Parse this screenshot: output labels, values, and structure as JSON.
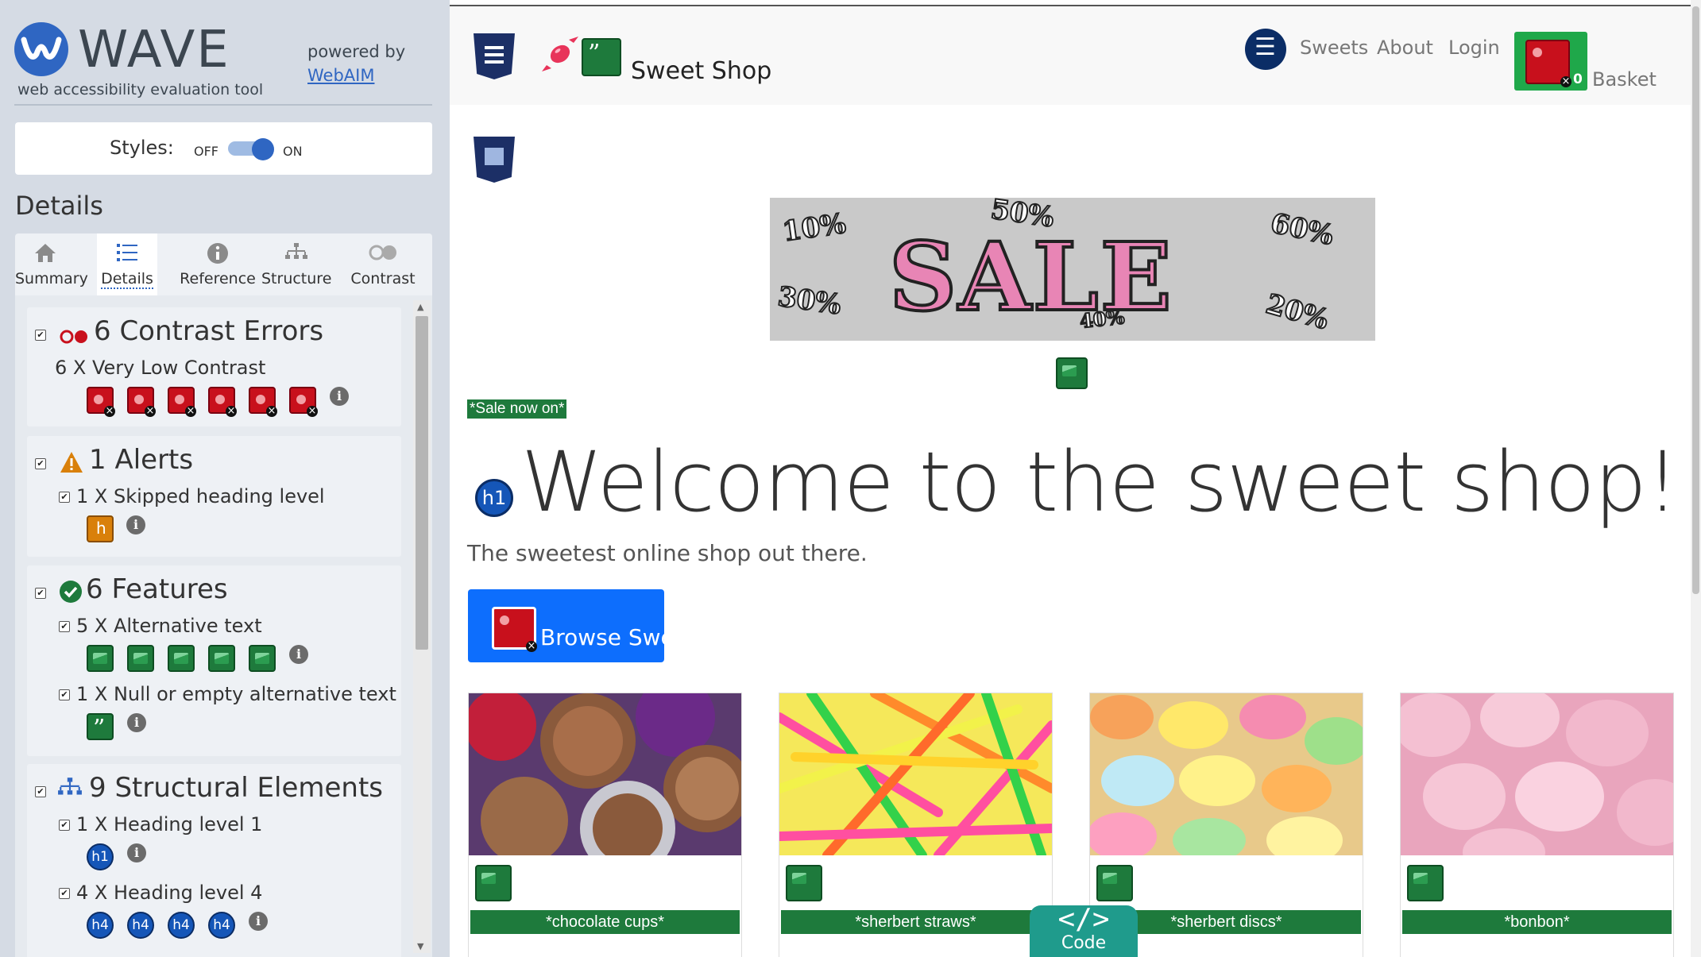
{
  "wave": {
    "title": "WAVE",
    "subtitle": "web accessibility evaluation tool",
    "powered_by": "powered by",
    "webaim": "WebAIM",
    "styles_label": "Styles:",
    "toggle_off": "OFF",
    "toggle_on": "ON",
    "details_heading": "Details",
    "tabs": [
      {
        "label": "Summary",
        "icon": "home-icon"
      },
      {
        "label": "Details",
        "icon": "list-icon",
        "active": true
      },
      {
        "label": "Reference",
        "icon": "info-icon"
      },
      {
        "label": "Structure",
        "icon": "structure-icon"
      },
      {
        "label": "Contrast",
        "icon": "contrast-icon"
      }
    ],
    "errors": {
      "title": "6 Contrast Errors",
      "item": "6 X Very Low Contrast",
      "count": 6
    },
    "alerts": {
      "title": "1 Alerts",
      "item": "1 X Skipped heading level",
      "count": 1
    },
    "features": {
      "title": "6 Features",
      "items": [
        {
          "label": "5 X Alternative text",
          "count": 5
        },
        {
          "label": "1 X Null or empty alternative text",
          "count": 1
        }
      ]
    },
    "structure": {
      "title": "9 Structural Elements",
      "items": [
        {
          "label": "1 X Heading level 1",
          "badge": "h1",
          "count": 1
        },
        {
          "label": "4 X Heading level 4",
          "badge": "h4",
          "count": 4
        }
      ]
    },
    "colors": {
      "error": "#c8101c",
      "alert": "#d9800a",
      "feature": "#1e7a3c",
      "structure": "#1556b8",
      "panel": "#d5dbe4"
    }
  },
  "site": {
    "brand": "Sweet Shop",
    "nav": [
      "Sweets",
      "About",
      "Login"
    ],
    "basket_count": "0",
    "basket_label": "Basket",
    "banner": {
      "word": "SALE",
      "percents": [
        "10%",
        "50%",
        "60%",
        "30%",
        "40%",
        "20%"
      ]
    },
    "banner_caption": "*Sale now on*",
    "h1_badge": "h1",
    "heading": "Welcome to the sweet shop!",
    "lead": "The sweetest online shop out there.",
    "browse_button": "Browse Sweets",
    "products": [
      "*chocolate cups*",
      "*sherbert straws*",
      "*sherbert discs*",
      "*bonbon*"
    ],
    "code_symbol": "</>",
    "code_label": "Code"
  }
}
